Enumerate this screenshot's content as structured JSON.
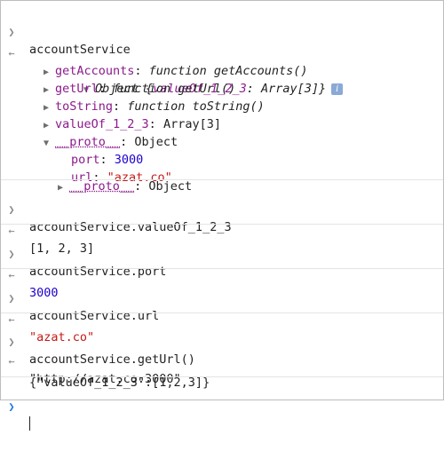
{
  "icons": {
    "input": "chevron-right-icon",
    "output": "return-arrow-icon",
    "expanded": "triangle-down-icon",
    "collapsed": "triangle-right-icon",
    "info": "info-icon"
  },
  "entries": [
    {
      "command": "accountService"
    },
    {
      "object": {
        "summary_prefix": "Object {",
        "summary_key": "valueOf_1_2_3",
        "summary_sep": ": ",
        "summary_value": "Array[3]",
        "summary_suffix": "}",
        "info_glyph": "i",
        "props": [
          {
            "key": "getAccounts",
            "sep": ": ",
            "value": "function getAccounts()"
          },
          {
            "key": "getUrl",
            "sep": ": ",
            "value": "function getUrl()"
          },
          {
            "key": "toString",
            "sep": ": ",
            "value": "function toString()"
          },
          {
            "key": "valueOf_1_2_3",
            "sep": ": ",
            "value": "Array[3]"
          }
        ],
        "proto": {
          "key": "__proto__",
          "sep": ": ",
          "value": "Object",
          "props": [
            {
              "key": "port",
              "sep": ": ",
              "value": "3000"
            },
            {
              "key": "url",
              "sep": ": ",
              "value": "\"azat.co\""
            }
          ],
          "nested_key": "__proto__",
          "nested_value": "Object"
        }
      }
    }
  ],
  "commands": [
    {
      "input": "accountService.valueOf_1_2_3",
      "output": "[1, 2, 3]"
    },
    {
      "input": "accountService.port",
      "output": "3000"
    },
    {
      "input": "accountService.url",
      "output": "\"azat.co\""
    },
    {
      "input": "accountService.getUrl()",
      "output": "\"http://azat.co:3000\"",
      "log": "{\"valueOf_1_2_3\":[1,2,3]}"
    }
  ],
  "colors": {
    "key": "#8b1a8b",
    "number": "#1c00cf",
    "string": "#c41a16",
    "prompt": "#1a73e8"
  }
}
